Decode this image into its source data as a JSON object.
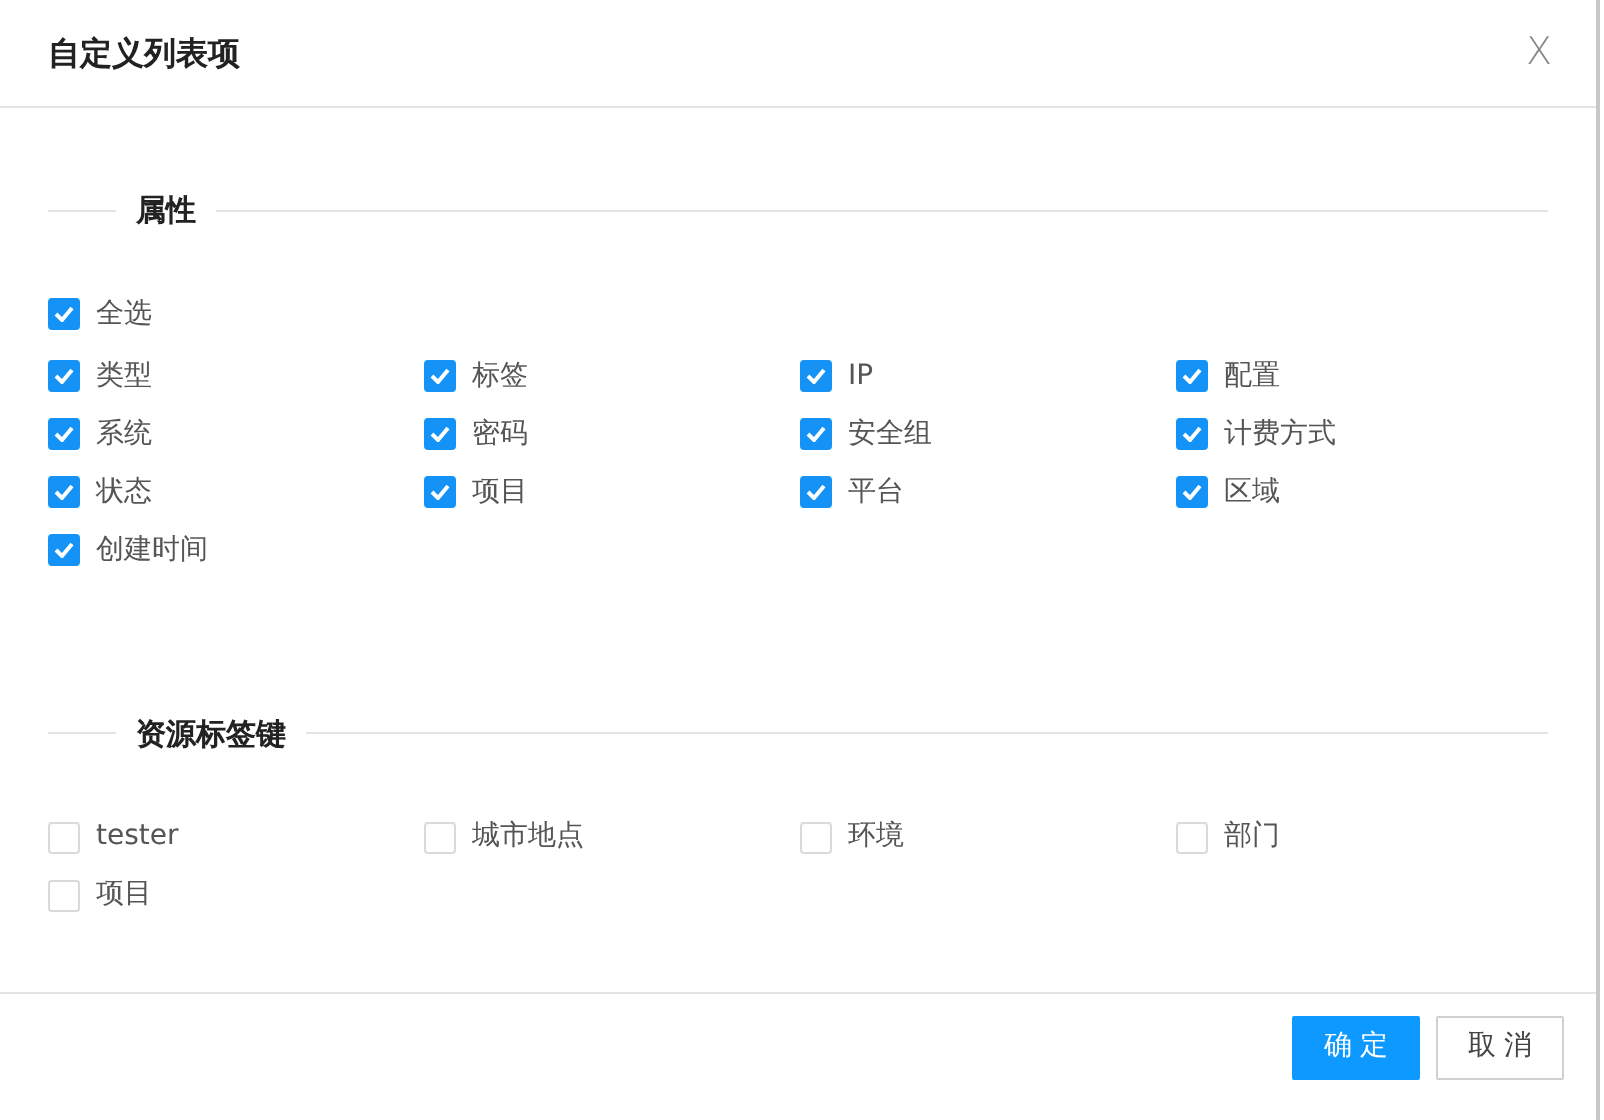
{
  "dialog": {
    "title": "自定义列表项",
    "close": "X"
  },
  "sections": [
    {
      "title": "属性",
      "select_all": {
        "label": "全选",
        "checked": true
      },
      "items": [
        {
          "label": "类型",
          "checked": true
        },
        {
          "label": "标签",
          "checked": true
        },
        {
          "label": "IP",
          "checked": true
        },
        {
          "label": "配置",
          "checked": true
        },
        {
          "label": "系统",
          "checked": true
        },
        {
          "label": "密码",
          "checked": true
        },
        {
          "label": "安全组",
          "checked": true
        },
        {
          "label": "计费方式",
          "checked": true
        },
        {
          "label": "状态",
          "checked": true
        },
        {
          "label": "项目",
          "checked": true
        },
        {
          "label": "平台",
          "checked": true
        },
        {
          "label": "区域",
          "checked": true
        },
        {
          "label": "创建时间",
          "checked": true
        }
      ]
    },
    {
      "title": "资源标签键",
      "items": [
        {
          "label": "tester",
          "checked": false
        },
        {
          "label": "城市地点",
          "checked": false
        },
        {
          "label": "环境",
          "checked": false
        },
        {
          "label": "部门",
          "checked": false
        },
        {
          "label": "项目",
          "checked": false
        }
      ]
    }
  ],
  "buttons": [
    {
      "label": "确 定",
      "kind": "primary"
    },
    {
      "label": "取 消",
      "kind": "secondary"
    }
  ]
}
